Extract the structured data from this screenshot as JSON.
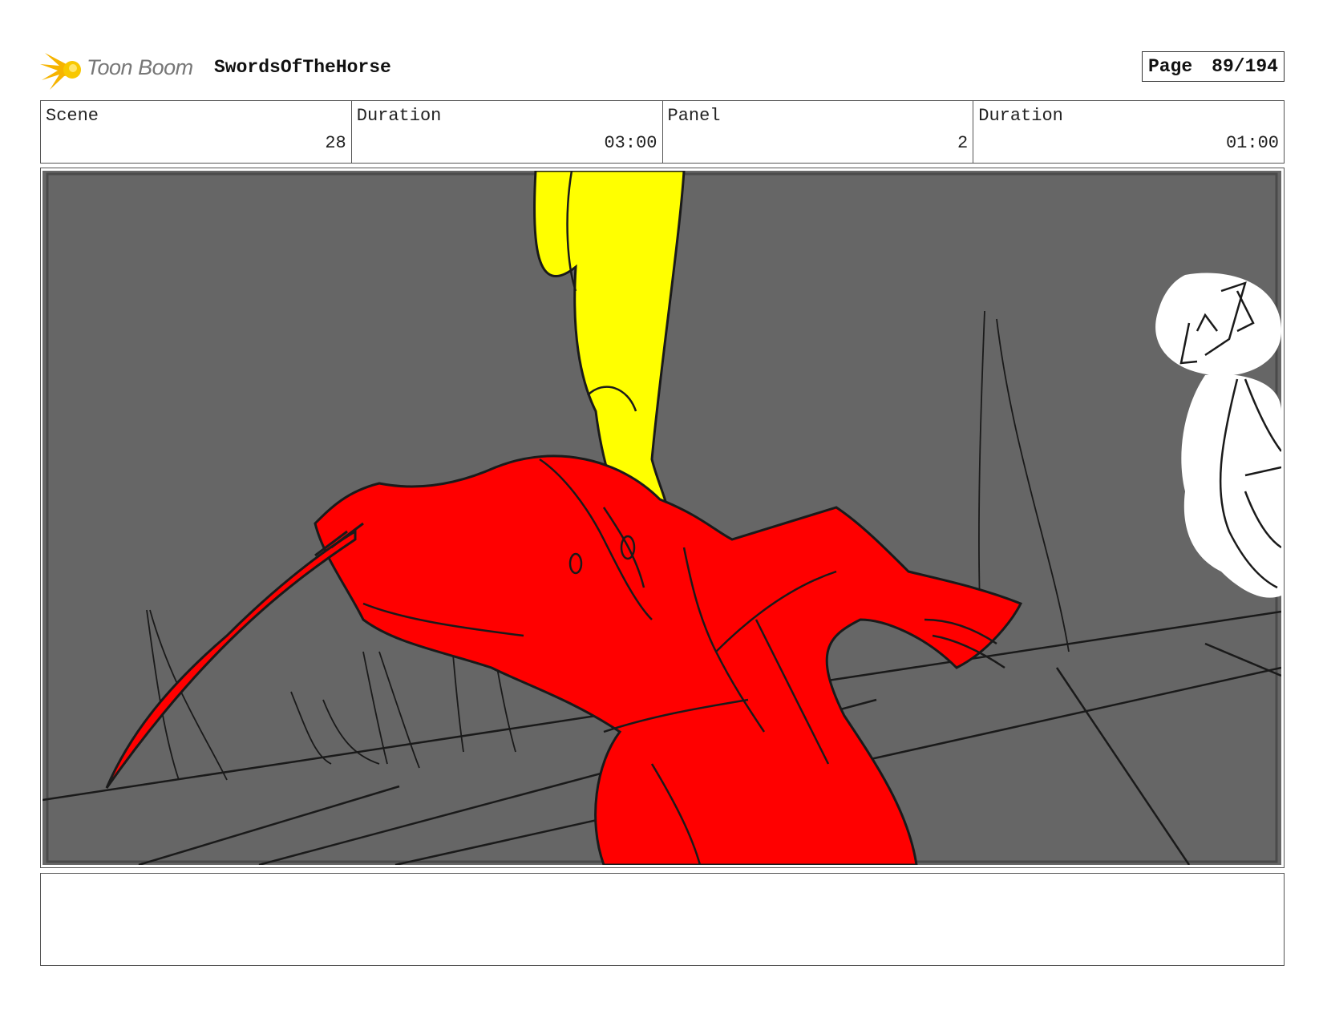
{
  "header": {
    "logo_text": "Toon Boom",
    "project_title": "SwordsOfTheHorse",
    "page_label": "Page",
    "page_number": "89/194"
  },
  "info": {
    "scene_label": "Scene",
    "scene_value": "28",
    "scene_duration_label": "Duration",
    "scene_duration_value": "03:00",
    "panel_label": "Panel",
    "panel_value": "2",
    "panel_duration_label": "Duration",
    "panel_duration_value": "01:00"
  },
  "notes": {
    "text": ""
  },
  "colors": {
    "background": "#666666",
    "character_red": "#ff0000",
    "character_yellow": "#ffff00",
    "sketch_line": "#1a1a1a",
    "logo_orange": "#f5b800"
  }
}
